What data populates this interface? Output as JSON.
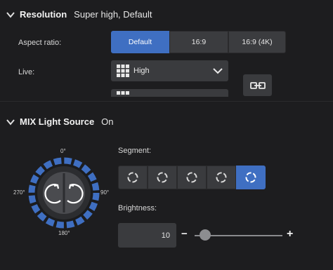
{
  "resolution": {
    "title": "Resolution",
    "value": "Super high, Default",
    "aspect_label": "Aspect ratio:",
    "aspect_options": [
      "Default",
      "16:9",
      "16:9 (4K)"
    ],
    "aspect_selected": "Default",
    "live_label": "Live:",
    "live_value": "High"
  },
  "mix_light": {
    "title": "MIX Light Source",
    "value": "On",
    "ring_labels": {
      "top": "0°",
      "right": "90°",
      "bottom": "180°",
      "left": "270°"
    },
    "segment_label": "Segment:",
    "segment_count": 5,
    "segment_selected_index": 4,
    "brightness_label": "Brightness:",
    "brightness_value": "10",
    "minus_label": "−",
    "plus_label": "+",
    "brightness_fraction": 0.12
  },
  "colors": {
    "accent": "#3f6fc2",
    "background": "#1d1d1f",
    "control": "#3a3b3e"
  }
}
